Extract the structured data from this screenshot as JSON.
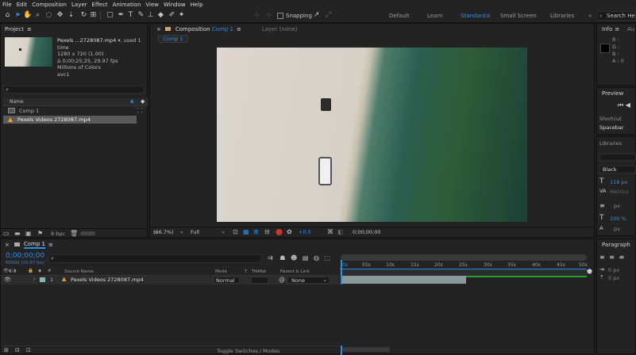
{
  "menu": [
    "File",
    "Edit",
    "Composition",
    "Layer",
    "Effect",
    "Animation",
    "View",
    "Window",
    "Help"
  ],
  "toolbar": {
    "snapping": "Snapping"
  },
  "workspaces": [
    {
      "label": "Default",
      "active": false
    },
    {
      "label": "Learn",
      "active": false
    },
    {
      "label": "Standard",
      "active": true
    },
    {
      "label": "Small Screen",
      "active": false
    },
    {
      "label": "Libraries",
      "active": false
    }
  ],
  "search": {
    "placeholder": "Search He"
  },
  "project": {
    "title": "Project",
    "file_name": "Pexels ...2728087.mp4",
    "used": ", used 1 time",
    "res": "1280 x 720 (1.00)",
    "duration": "Δ 0;00;25;25, 29.97 fps",
    "colors": "Millions of Colors",
    "codec": "avc1",
    "col_name": "Name",
    "items": [
      {
        "name": "Comp 1"
      },
      {
        "name": "Pexels Videos 2728087.mp4"
      }
    ],
    "bpc": "8 bpc"
  },
  "comp": {
    "tab_prefix": "Composition ",
    "tab_name": "Comp 1",
    "layer_tab": "Layer  (none)",
    "crumb": "Comp 1",
    "zoom": "(66.7%)",
    "res": "Full",
    "exposure": "+0.0",
    "time": "0;00;00;00"
  },
  "info": {
    "title": "Info",
    "next": "Au",
    "r": "R :",
    "g": "G :",
    "b": "B :",
    "a": "A : 0"
  },
  "preview": {
    "title": "Preview",
    "shortcut_label": "Shortcut",
    "shortcut": "Spacebar"
  },
  "libraries": {
    "title": "Libraries"
  },
  "character": {
    "font": "Black",
    "size": "118 px",
    "metrics": "Metrics",
    "unit": "px",
    "scale": "100 %",
    "px2": "px"
  },
  "paragraph": {
    "title": "Paragraph",
    "v1": "0 px",
    "v2": "0 px"
  },
  "timeline": {
    "tab": "Comp 1",
    "time": "0;00;00;00",
    "fps": "00000 (29.97 fps)",
    "cols": {
      "source": "Source Name",
      "mode": "Mode",
      "t": "T",
      "trkmat": "TrkMat",
      "parent": "Parent & Link"
    },
    "layer": {
      "num": "1",
      "name": "Pexels Videos 2728087.mp4",
      "mode": "Normal",
      "parent": "None"
    },
    "ticks": [
      "0s",
      "05s",
      "10s",
      "15s",
      "20s",
      "25s",
      "30s",
      "35s",
      "40s",
      "45s",
      "50s"
    ],
    "toggle": "Toggle Switches / Modes"
  }
}
